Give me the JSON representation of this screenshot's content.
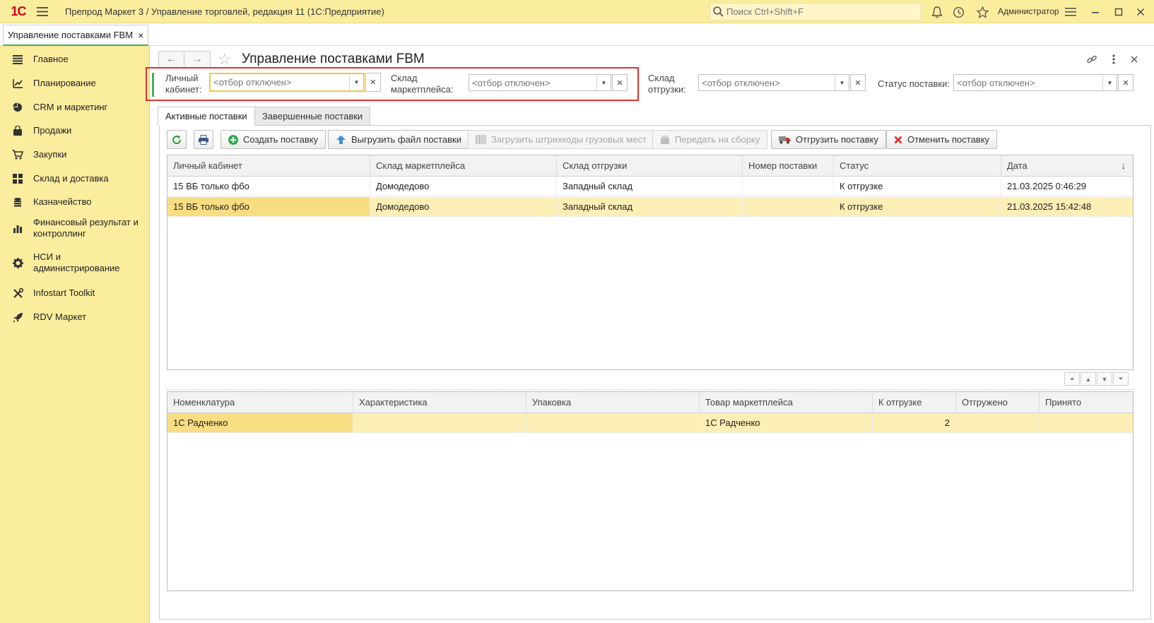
{
  "titlebar": {
    "logo": "1С",
    "title": "Препрод Маркет 3 / Управление торговлей, редакция 11  (1С:Предприятие)",
    "search_placeholder": "Поиск Ctrl+Shift+F",
    "user": "Администратор"
  },
  "open_tab": {
    "label": "Управление поставками FBM",
    "close": "×"
  },
  "sidebar": {
    "items": [
      {
        "label": "Главное",
        "icon": "menu-lines-icon"
      },
      {
        "label": "Планирование",
        "icon": "chart-up-icon"
      },
      {
        "label": "CRM и маркетинг",
        "icon": "pie-icon"
      },
      {
        "label": "Продажи",
        "icon": "bag-icon"
      },
      {
        "label": "Закупки",
        "icon": "cart-icon"
      },
      {
        "label": "Склад и доставка",
        "icon": "grid-icon"
      },
      {
        "label": "Казначейство",
        "icon": "coins-icon"
      },
      {
        "label": "Финансовый результат и контроллинг",
        "icon": "bars-icon"
      },
      {
        "label": "НСИ и администрирование",
        "icon": "gear-icon"
      },
      {
        "label": "Infostart Toolkit",
        "icon": "tools-icon"
      },
      {
        "label": "RDV Маркет",
        "icon": "rocket-icon"
      }
    ]
  },
  "page": {
    "title": "Управление поставками FBM",
    "back": "←",
    "forward": "→",
    "star": "☆"
  },
  "filters": {
    "cabinet_label": "Личный\nкабинет:",
    "cabinet_placeholder": "<отбор отключен>",
    "mp_warehouse_label": "Склад\nмаркетплейса:",
    "mp_warehouse_placeholder": "<отбор отключен>",
    "ship_warehouse_label": "Склад\nотгрузки:",
    "ship_warehouse_placeholder": "<отбор отключен>",
    "status_label": "Статус поставки:",
    "status_placeholder": "<отбор отключен>"
  },
  "tabs": {
    "active": "Активные поставки",
    "finished": "Завершенные поставки"
  },
  "toolbar": {
    "create": "Создать поставку",
    "export": "Выгрузить файл поставки",
    "load_barcodes": "Загрузить штрихкоды грузовых мест",
    "to_assembly": "Передать на сборку",
    "ship": "Отгрузить поставку",
    "cancel": "Отменить поставку"
  },
  "supplies_table": {
    "columns": [
      "Личный кабинет",
      "Склад маркетплейса",
      "Склад отгрузки",
      "Номер поставки",
      "Статус",
      "Дата"
    ],
    "sort_indicator": "↓",
    "rows": [
      [
        "15 ВБ только фбо",
        "Домодедово",
        "Западный склад",
        "",
        "К отгрузке",
        "21.03.2025 0:46:29"
      ],
      [
        "15 ВБ только фбо",
        "Домодедово",
        "Западный склад",
        "",
        "К отгрузке",
        "21.03.2025 15:42:48"
      ]
    ]
  },
  "goods_table": {
    "columns": [
      "Номенклатура",
      "Характеристика",
      "Упаковка",
      "Товар маркетплейса",
      "К отгрузке",
      "Отгружено",
      "Принято"
    ],
    "rows": [
      [
        "1С Радченко",
        "",
        "",
        "1С Радченко",
        "2",
        "",
        ""
      ]
    ]
  },
  "colors": {
    "titlebar_bg": "#fbed9e",
    "sidebar_bg": "#fbed9e",
    "selected_row": "#fcefb6",
    "current_cell": "#f8dd82",
    "highlight_frame": "#e0332d",
    "accent_green": "#4caf50"
  }
}
